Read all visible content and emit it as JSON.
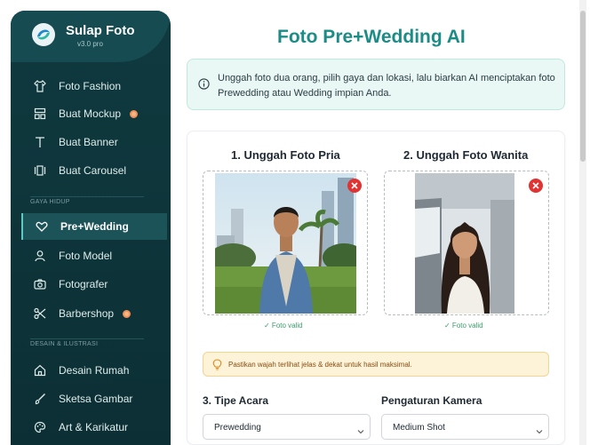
{
  "app": {
    "name": "Sulap Foto",
    "version": "v3.0 pro"
  },
  "sidebar": {
    "items": [
      {
        "label": "Foto Fashion",
        "icon": "shirt-icon"
      },
      {
        "label": "Buat Mockup",
        "icon": "mockup-icon",
        "badge": true
      },
      {
        "label": "Buat Banner",
        "icon": "text-icon"
      },
      {
        "label": "Buat Carousel",
        "icon": "carousel-icon"
      }
    ],
    "section_lifestyle": "GAYA HIDUP",
    "lifestyle_items": [
      {
        "label": "Pre+Wedding",
        "icon": "heart-icon",
        "active": true
      },
      {
        "label": "Foto Model",
        "icon": "person-icon"
      },
      {
        "label": "Fotografer",
        "icon": "camera-icon"
      },
      {
        "label": "Barbershop",
        "icon": "scissors-icon",
        "badge": true
      }
    ],
    "section_design": "DESAIN & ILUSTRASI",
    "design_items": [
      {
        "label": "Desain Rumah",
        "icon": "house-icon"
      },
      {
        "label": "Sketsa Gambar",
        "icon": "brush-icon"
      },
      {
        "label": "Art & Karikatur",
        "icon": "palette-icon"
      }
    ]
  },
  "main": {
    "title": "Foto Pre+Wedding AI",
    "info": "Unggah foto dua orang, pilih gaya dan lokasi, lalu biarkan AI menciptakan foto Prewedding atau Wedding impian Anda.",
    "upload_male_title": "1. Unggah Foto Pria",
    "upload_female_title": "2. Unggah Foto Wanita",
    "valid_male": "✓ Foto valid",
    "valid_female": "✓ Foto valid",
    "tip": "Pastikan wajah terlihat jelas & dekat untuk hasil maksimal.",
    "event_type_label": "3. Tipe Acara",
    "event_type_value": "Prewedding",
    "camera_label": "Pengaturan Kamera",
    "camera_value": "Medium Shot"
  },
  "colors": {
    "sidebar_bg": "#0f3a3f",
    "accent": "#1b8c86",
    "danger": "#e03333",
    "valid": "#38a169"
  }
}
